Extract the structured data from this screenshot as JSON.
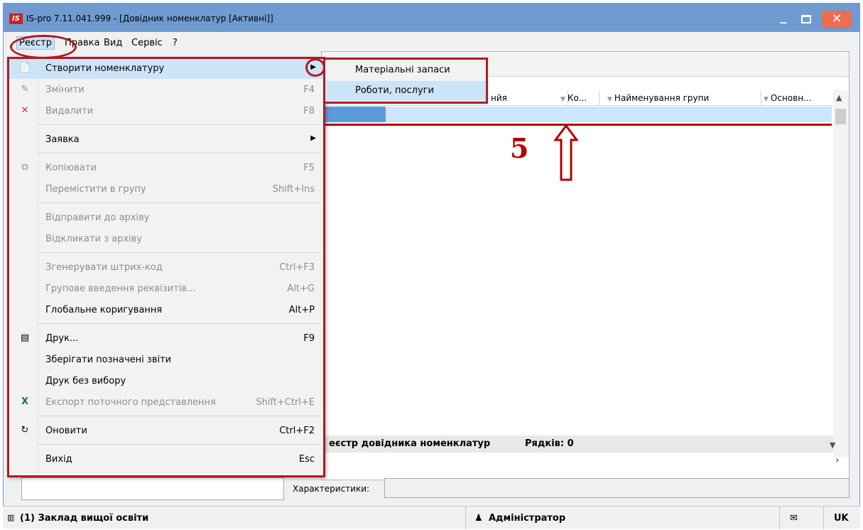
{
  "window": {
    "logo": "IS",
    "title": "IS-pro 7.11.041.999 - [Довідник номенклатур [Активні]]",
    "minimize_label": "_",
    "close_label": "✕"
  },
  "menubar": {
    "items": [
      {
        "label": "Реєстр"
      },
      {
        "label": "Правка"
      },
      {
        "label": "Вид"
      },
      {
        "label": "Сервіс"
      },
      {
        "label": "?"
      }
    ]
  },
  "menu": {
    "items": [
      {
        "label": "Створити номенклатуру",
        "shortcut": "",
        "submenu": true,
        "disabled": false,
        "icon": "create-icon"
      },
      {
        "label": "Змінити",
        "shortcut": "F4",
        "disabled": true,
        "icon": "edit-icon"
      },
      {
        "label": "Видалити",
        "shortcut": "F8",
        "disabled": true,
        "icon": "delete-icon"
      },
      {
        "label": "Заявка",
        "shortcut": "",
        "submenu": true,
        "disabled": false,
        "icon": ""
      },
      {
        "label": "Копіювати",
        "shortcut": "F5",
        "disabled": true,
        "icon": "copy-icon"
      },
      {
        "label": "Перемістити в групу",
        "shortcut": "Shift+Ins",
        "disabled": true,
        "icon": ""
      },
      {
        "label": "Відправити до архіву",
        "shortcut": "",
        "disabled": true,
        "icon": ""
      },
      {
        "label": "Відкликати з архіву",
        "shortcut": "",
        "disabled": true,
        "icon": ""
      },
      {
        "label": "Згенерувати штрих-код",
        "shortcut": "Ctrl+F3",
        "disabled": true,
        "icon": ""
      },
      {
        "label": "Групове введення реквізитів...",
        "shortcut": "Alt+G",
        "disabled": true,
        "icon": ""
      },
      {
        "label": "Глобальне коригування",
        "shortcut": "Alt+P",
        "disabled": false,
        "icon": ""
      },
      {
        "label": "Друк...",
        "shortcut": "F9",
        "disabled": false,
        "icon": "print-icon"
      },
      {
        "label": "Зберігати позначені звіти",
        "shortcut": "",
        "disabled": false,
        "icon": ""
      },
      {
        "label": "Друк без вибору",
        "shortcut": "",
        "disabled": false,
        "icon": ""
      },
      {
        "label": "Експорт поточного представлення",
        "shortcut": "Shift+Ctrl+E",
        "disabled": true,
        "icon": "excel-icon"
      },
      {
        "label": "Оновити",
        "shortcut": "Ctrl+F2",
        "disabled": false,
        "icon": "refresh-icon"
      },
      {
        "label": "Вихід",
        "shortcut": "Esc",
        "disabled": false,
        "icon": ""
      }
    ]
  },
  "submenu": {
    "items": [
      {
        "label": "Матеріальні запаси"
      },
      {
        "label": "Роботи, послуги"
      }
    ]
  },
  "grid": {
    "columns": [
      {
        "label": "нйя"
      },
      {
        "label": "Ко..."
      },
      {
        "label": "Найменування групи"
      },
      {
        "label": "Основн..."
      }
    ],
    "footer_title": "еєстр довідника номенклатур",
    "rows_label": "Рядків: 0"
  },
  "fields": {
    "characteristics_label": "Характеристики:"
  },
  "statusbar": {
    "org": "(1) Заклад вищої освіти",
    "user": "Адміністратор",
    "lang": "UK"
  },
  "annotation": {
    "step": "5"
  }
}
